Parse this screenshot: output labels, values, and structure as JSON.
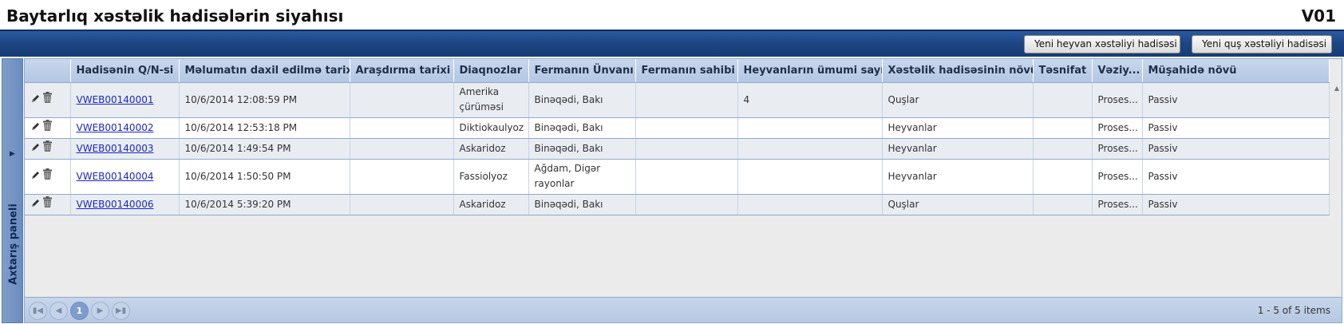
{
  "header": {
    "title": "Baytarlıq xəstəlik hadisələrin siyahısı",
    "code": "V01"
  },
  "toolbar": {
    "new_animal_label": "Yeni heyvan xəstəliyi hadisəsi",
    "new_bird_label": "Yeni quş xəstəliyi hadisəsi"
  },
  "side_panel": {
    "label": "Axtarış paneli"
  },
  "table": {
    "columns": [
      "",
      "Hadisənin Q/N-si",
      "Məlumatın daxil edilmə tarixi",
      "Araşdırma tarixi",
      "Diaqnozlar",
      "Fermanın Ünvanı",
      "Fermanın sahibi",
      "Heyvanların ümumi sayı",
      "Xəstəlik hadisəsinin növü",
      "Təsnifat",
      "Vəziy...",
      "Müşahidə növü"
    ],
    "rows": [
      {
        "id": "VWEB00140001",
        "entry_date": "10/6/2014 12:08:59 PM",
        "research_date": "",
        "diagnosis": "Amerika çürüməsi",
        "address": "Binəqədi, Bakı",
        "owner": "",
        "total": "4",
        "type": "Quşlar",
        "classification": "",
        "status": "Proses...",
        "observation": "Passiv"
      },
      {
        "id": "VWEB00140002",
        "entry_date": "10/6/2014 12:53:18 PM",
        "research_date": "",
        "diagnosis": "Diktiokaulyoz",
        "address": "Binəqədi, Bakı",
        "owner": "",
        "total": "",
        "type": "Heyvanlar",
        "classification": "",
        "status": "Proses...",
        "observation": "Passiv"
      },
      {
        "id": "VWEB00140003",
        "entry_date": "10/6/2014 1:49:54 PM",
        "research_date": "",
        "diagnosis": "Askaridoz",
        "address": "Binəqədi, Bakı",
        "owner": "",
        "total": "",
        "type": "Heyvanlar",
        "classification": "",
        "status": "Proses...",
        "observation": "Passiv"
      },
      {
        "id": "VWEB00140004",
        "entry_date": "10/6/2014 1:50:50 PM",
        "research_date": "",
        "diagnosis": "Fassiolyoz",
        "address": "Ağdam, Digər rayonlar",
        "owner": "",
        "total": "",
        "type": "Heyvanlar",
        "classification": "",
        "status": "Proses...",
        "observation": "Passiv"
      },
      {
        "id": "VWEB00140006",
        "entry_date": "10/6/2014 5:39:20 PM",
        "research_date": "",
        "diagnosis": "Askaridoz",
        "address": "Binəqədi, Bakı",
        "owner": "",
        "total": "",
        "type": "Quşlar",
        "classification": "",
        "status": "Proses...",
        "observation": "Passiv"
      }
    ]
  },
  "pager": {
    "current_page": "1",
    "info": "1 - 5 of 5 items"
  }
}
